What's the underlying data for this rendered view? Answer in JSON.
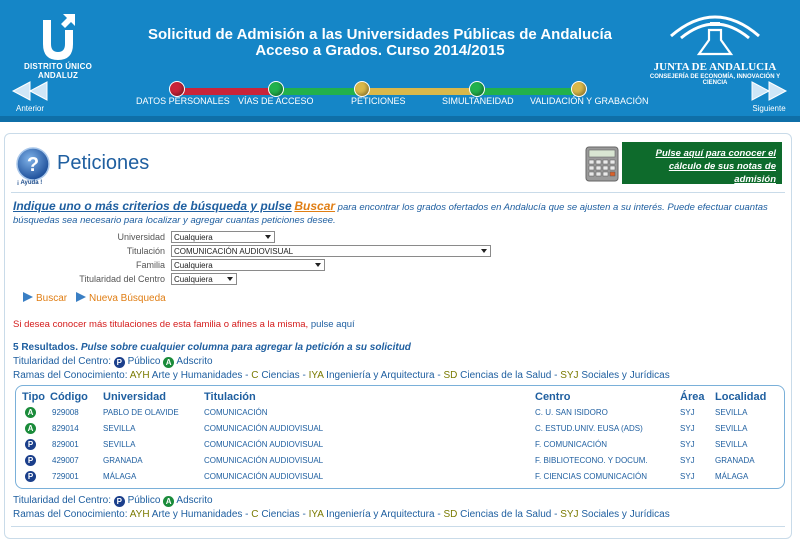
{
  "header": {
    "title_line1": "Solicitud de Admisión a las Universidades Públicas de Andalucía",
    "title_line2": "Acceso a Grados. Curso 2014/2015",
    "left_logo_text": "DISTRITO ÚNICO ANDALUZ",
    "right_logo_name": "JUNTA DE ANDALUCIA",
    "right_logo_sub": "CONSEJERÍA DE ECONOMÍA, INNOVACIÓN Y CIENCIA",
    "prev_label": "Anterior",
    "next_label": "Siguiente"
  },
  "steps": [
    {
      "label": "DATOS PERSONALES",
      "color": "#c9243a"
    },
    {
      "label": "VÍAS DE ACCESO",
      "color": "#22b14c"
    },
    {
      "label": "PETICIONES",
      "color": "#d9b84a"
    },
    {
      "label": "SIMULTANEIDAD",
      "color": "#22b14c"
    },
    {
      "label": "VALIDACIÓN Y GRABACIÓN",
      "color": "#d9b84a"
    }
  ],
  "page": {
    "title": "Peticiones",
    "help_label": "¡ Ayuda !",
    "calc_link": "Pulse aquí para conocer el cálculo de sus notas de admisión"
  },
  "search": {
    "intro_lead": "Indique uno o más criterios de búsqueda y pulse",
    "intro_buscar": "Buscar",
    "intro_rest": " para encontrar los grados ofertados en Andalucía que se ajusten a su interés. Puede efectuar cuantas búsquedas sea necesario para localizar y agregar cuantas peticiones desee.",
    "fields": {
      "universidad": {
        "label": "Universidad",
        "value": "Cualquiera"
      },
      "titulacion": {
        "label": "Titulación",
        "value": "COMUNICACIÓN AUDIOVISUAL"
      },
      "familia": {
        "label": "Familia",
        "value": "Cualquiera"
      },
      "titularidad": {
        "label": "Titularidad del Centro",
        "value": "Cualquiera"
      }
    },
    "buscar_label": "Buscar",
    "nueva_label": "Nueva Búsqueda",
    "more_text": "Si desea conocer más titulaciones de esta familia o afines a la misma,",
    "more_link": " pulse aquí"
  },
  "results": {
    "count_label": "5 Resultados.",
    "instruction": "Pulse sobre cualquier columna para agregar la petición a su solicitud",
    "titularidad_label": "Titularidad del Centro:",
    "publico_badge": "P",
    "publico_label": "Público",
    "adscrito_badge": "A",
    "adscrito_label": "Adscrito",
    "ramas_label": "Ramas del Conocimiento:",
    "ramas": [
      {
        "code": "AYH",
        "name": "Arte y Humanidades"
      },
      {
        "code": "C",
        "name": "Ciencias"
      },
      {
        "code": "IYA",
        "name": "Ingeniería y Arquitectura"
      },
      {
        "code": "SD",
        "name": "Ciencias de la Salud"
      },
      {
        "code": "SYJ",
        "name": "Sociales y Jurídicas"
      }
    ],
    "columns": [
      "Tipo",
      "Código",
      "Universidad",
      "Titulación",
      "Centro",
      "Área",
      "Localidad"
    ],
    "rows": [
      {
        "tipo": "A",
        "codigo": "929008",
        "universidad": "PABLO DE OLAVIDE",
        "titulacion": "COMUNICACIÓN",
        "centro": "C. U. SAN ISIDORO",
        "area": "SYJ",
        "localidad": "SEVILLA"
      },
      {
        "tipo": "A",
        "codigo": "829014",
        "universidad": "SEVILLA",
        "titulacion": "COMUNICACIÓN AUDIOVISUAL",
        "centro": "C. ESTUD.UNIV. EUSA (ADS)",
        "area": "SYJ",
        "localidad": "SEVILLA"
      },
      {
        "tipo": "P",
        "codigo": "829001",
        "universidad": "SEVILLA",
        "titulacion": "COMUNICACIÓN AUDIOVISUAL",
        "centro": "F. COMUNICACIÓN",
        "area": "SYJ",
        "localidad": "SEVILLA"
      },
      {
        "tipo": "P",
        "codigo": "429007",
        "universidad": "GRANADA",
        "titulacion": "COMUNICACIÓN AUDIOVISUAL",
        "centro": "F. BIBLIOTECONO. Y DOCUM.",
        "area": "SYJ",
        "localidad": "GRANADA"
      },
      {
        "tipo": "P",
        "codigo": "729001",
        "universidad": "MÁLAGA",
        "titulacion": "COMUNICACIÓN AUDIOVISUAL",
        "centro": "F. CIENCIAS COMUNICACIÓN",
        "area": "SYJ",
        "localidad": "MÁLAGA"
      }
    ]
  },
  "colors": {
    "header_bg": "#1586c7",
    "title_blue": "#1f5fa0",
    "accent_orange": "#e07e14",
    "calc_green": "#0e6b2c",
    "publico_badge": "#1b3f8b",
    "adscrito_badge": "#1a8b3a"
  },
  "icons": {
    "prev": "double-left-arrow-icon",
    "next": "double-right-arrow-icon",
    "help": "question-mark-icon",
    "calc": "calculator-icon"
  }
}
